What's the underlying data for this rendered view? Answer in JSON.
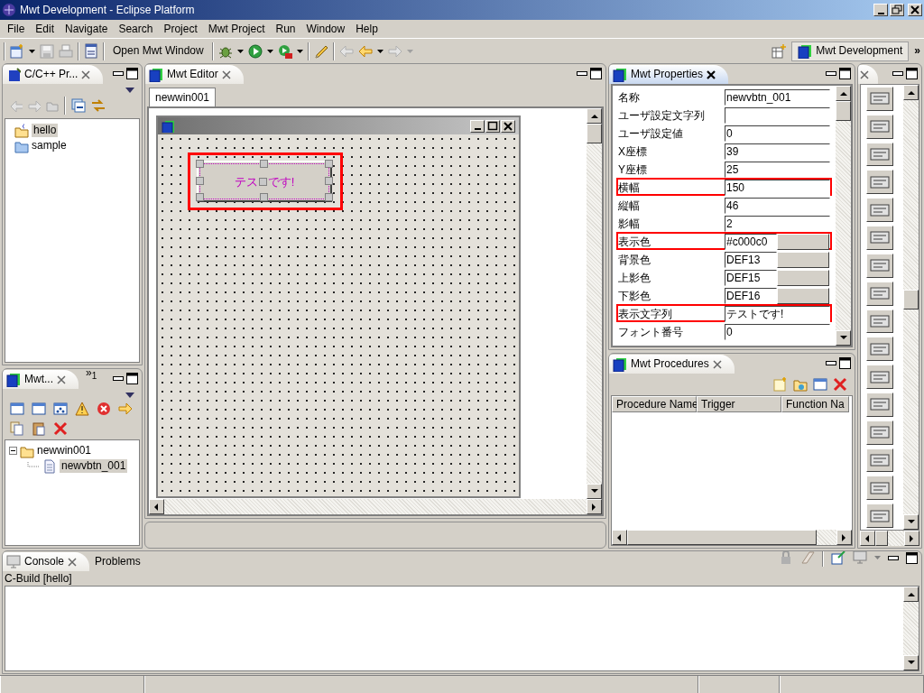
{
  "window": {
    "title": "Mwt Development - Eclipse Platform"
  },
  "menu": [
    "File",
    "Edit",
    "Navigate",
    "Search",
    "Project",
    "Mwt Project",
    "Run",
    "Window",
    "Help"
  ],
  "toolbar": {
    "open_window_button": "Open Mwt Window"
  },
  "perspective": {
    "label": "Mwt Development",
    "selected": true,
    "overflow": "»"
  },
  "project_explorer": {
    "title": "C/C++ Pr...",
    "items": [
      {
        "label": "hello",
        "kind": "project",
        "selected": true
      },
      {
        "label": "sample",
        "kind": "folder",
        "selected": false
      }
    ]
  },
  "mwt_tree_view": {
    "title": "Mwt...",
    "overflow": "»",
    "overflow_count": "1",
    "items": [
      {
        "label": "newwin001",
        "kind": "folder",
        "expanded": true,
        "selected": false,
        "children": [
          {
            "label": "newvbtn_001",
            "kind": "file",
            "selected": true
          }
        ]
      }
    ]
  },
  "editor": {
    "title": "Mwt Editor",
    "tabs": [
      {
        "label": "newwin001",
        "selected": true
      }
    ],
    "widget": {
      "text_parts": [
        "テス",
        "です!"
      ],
      "highlighted": true
    }
  },
  "properties": {
    "title": "Mwt Properties",
    "rows": [
      {
        "label": "名称",
        "value": "newvbtn_001",
        "kind": "text",
        "highlighted": false
      },
      {
        "label": "ユーザ設定文字列",
        "value": "",
        "kind": "text",
        "highlighted": false
      },
      {
        "label": "ユーザ設定値",
        "value": "0",
        "kind": "text",
        "highlighted": false
      },
      {
        "label": "X座標",
        "value": "39",
        "kind": "text",
        "highlighted": false
      },
      {
        "label": "Y座標",
        "value": "25",
        "kind": "text",
        "highlighted": false
      },
      {
        "label": "横幅",
        "value": "150",
        "kind": "text",
        "highlighted": true
      },
      {
        "label": "縦幅",
        "value": "46",
        "kind": "text",
        "highlighted": false
      },
      {
        "label": "影幅",
        "value": "2",
        "kind": "text",
        "highlighted": false
      },
      {
        "label": "表示色",
        "value": "#c000c0",
        "kind": "color",
        "highlighted": true
      },
      {
        "label": "背景色",
        "value": "DEF13",
        "kind": "color",
        "highlighted": false
      },
      {
        "label": "上影色",
        "value": "DEF15",
        "kind": "color",
        "highlighted": false
      },
      {
        "label": "下影色",
        "value": "DEF16",
        "kind": "color",
        "highlighted": false
      },
      {
        "label": "表示文字列",
        "value": "テストです!",
        "kind": "text",
        "highlighted": true
      },
      {
        "label": "フォント番号",
        "value": "0",
        "kind": "text",
        "highlighted": false
      }
    ]
  },
  "procedures": {
    "title": "Mwt Procedures",
    "columns": [
      "Procedure Name",
      "Trigger",
      "Function Na"
    ]
  },
  "console": {
    "tabs": [
      {
        "label": "Console",
        "selected": true
      },
      {
        "label": "Problems",
        "selected": false
      }
    ],
    "text": "C-Build [hello]"
  }
}
